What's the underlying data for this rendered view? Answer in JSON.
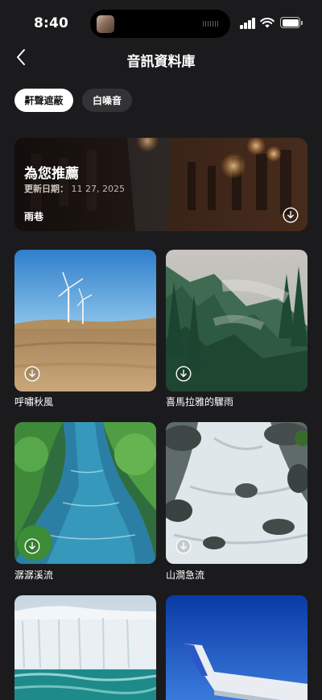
{
  "status_bar": {
    "time": "8:40"
  },
  "header": {
    "title": "音訊資料庫",
    "back_icon": "chevron-left-icon"
  },
  "tabs": [
    {
      "label": "鼾聲遮蔽",
      "selected": true
    },
    {
      "label": "白噪音",
      "selected": false
    }
  ],
  "featured": {
    "heading": "為您推薦",
    "date_label": "更新日期：",
    "date_value": "11 27, 2025",
    "track_name": "雨巷",
    "icon": "download-icon"
  },
  "tracks": [
    {
      "name": "呼嘯秋風",
      "icon": "download-icon"
    },
    {
      "name": "喜馬拉雅的驟雨",
      "icon": "download-icon"
    },
    {
      "name": "潺潺溪流",
      "icon": "download-icon"
    },
    {
      "name": "山澗急流",
      "icon": "download-icon"
    }
  ]
}
